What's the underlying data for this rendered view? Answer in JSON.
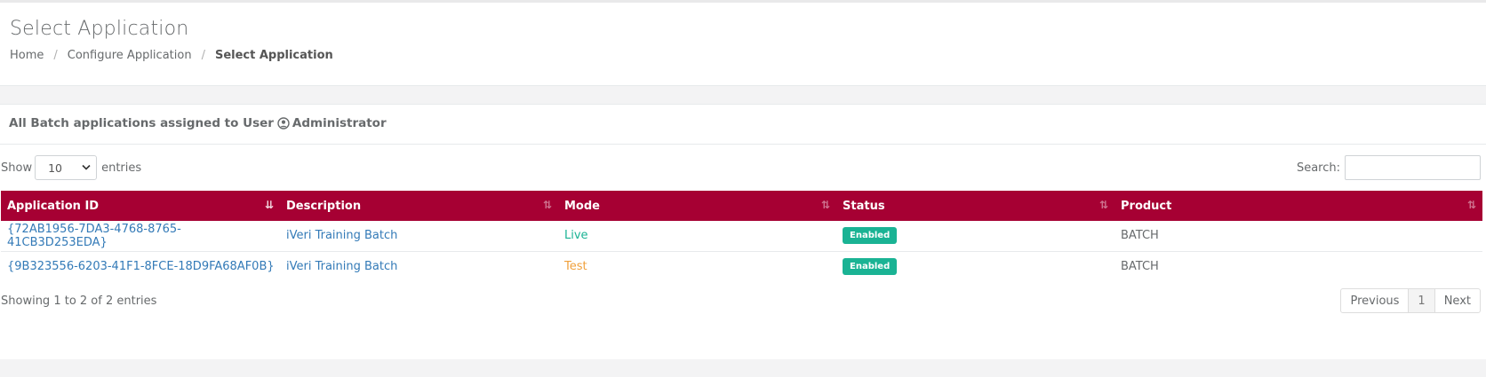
{
  "page": {
    "title": "Select Application",
    "breadcrumb": [
      "Home",
      "Configure Application",
      "Select Application"
    ]
  },
  "panel": {
    "title_prefix": "All Batch applications assigned to User",
    "user": "Administrator"
  },
  "controls": {
    "show_label": "Show",
    "entries_label": "entries",
    "page_length": "10",
    "search_label": "Search:",
    "search_value": ""
  },
  "table": {
    "columns": [
      "Application ID",
      "Description",
      "Mode",
      "Status",
      "Product"
    ],
    "rows": [
      {
        "id": "{72AB1956-7DA3-4768-8765-41CB3D253EDA}",
        "description": "iVeri Training Batch",
        "mode": "Live",
        "status": "Enabled",
        "product": "BATCH"
      },
      {
        "id": "{9B323556-6203-41F1-8FCE-18D9FA68AF0B}",
        "description": "iVeri Training Batch",
        "mode": "Test",
        "status": "Enabled",
        "product": "BATCH"
      }
    ]
  },
  "footer": {
    "info": "Showing 1 to 2 of 2 entries",
    "previous": "Previous",
    "current_page": "1",
    "next": "Next"
  },
  "colors": {
    "header_bg": "#a60033",
    "live": "#1ab394",
    "test": "#f0a03c",
    "badge": "#1ab394",
    "link": "#337ab7"
  },
  "icons": {
    "user": "user-circle-icon",
    "sort": "sort-icon",
    "chevron": "chevron-down-icon"
  }
}
